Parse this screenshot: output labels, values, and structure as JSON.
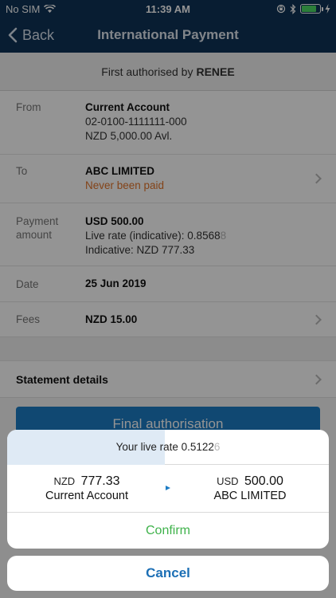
{
  "status_bar": {
    "carrier": "No SIM",
    "time": "11:39 AM",
    "battery_level": 0.8
  },
  "nav": {
    "back_label": "Back",
    "title": "International Payment"
  },
  "banner": {
    "text": "First authorised by",
    "name": "RENEE"
  },
  "details": {
    "from": {
      "label": "From",
      "account_name": "Current Account",
      "account_number": "02-0100-1111111-000",
      "available": "NZD 5,000.00 Avl."
    },
    "to": {
      "label": "To",
      "payee": "ABC LIMITED",
      "status": "Never been paid"
    },
    "amount": {
      "label_line1": "Payment",
      "label_line2": "amount",
      "value": "USD 500.00",
      "rate_label": "Live rate (indicative): 0.8568",
      "rate_fade": "8",
      "indicative": "Indicative: NZD 777.33"
    },
    "date": {
      "label": "Date",
      "value": "25 Jun 2019"
    },
    "fees": {
      "label": "Fees",
      "value": "NZD 15.00"
    }
  },
  "statement": {
    "title": "Statement details"
  },
  "final_button": {
    "label": "Final authorisation"
  },
  "sheet": {
    "rate_label": "Your live rate 0.5122",
    "rate_fade": "6",
    "rate_progress": 0.49,
    "from": {
      "currency": "NZD",
      "amount": "777.33",
      "account": "Current Account"
    },
    "to": {
      "currency": "USD",
      "amount": "500.00",
      "account": "ABC LIMITED"
    },
    "confirm_label": "Confirm"
  },
  "cancel_label": "Cancel",
  "colors": {
    "navy": "#0f3357",
    "accent_blue": "#1c7cc4",
    "confirm_green": "#3fb24b",
    "warning_orange": "#e2742a"
  }
}
